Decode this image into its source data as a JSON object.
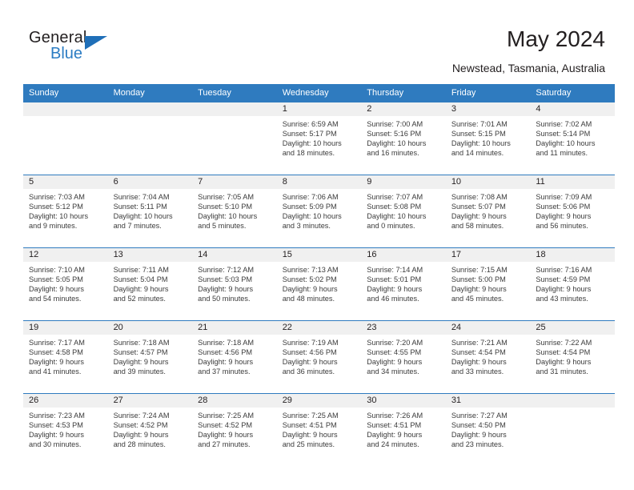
{
  "brand": {
    "name_top": "General",
    "name_bottom": "Blue",
    "triangle_icon": "triangle-icon",
    "accent_color": "#2f7bbf"
  },
  "header": {
    "title": "May 2024",
    "location": "Newstead, Tasmania, Australia"
  },
  "calendar": {
    "weekday_headers": [
      "Sunday",
      "Monday",
      "Tuesday",
      "Wednesday",
      "Thursday",
      "Friday",
      "Saturday"
    ],
    "header_bg": "#2f7bbf",
    "daynum_band_bg": "#f0f0f0",
    "weeks": [
      [
        {
          "day": "",
          "blank": true,
          "l1": "",
          "l2": "",
          "l3": "",
          "l4": ""
        },
        {
          "day": "",
          "blank": true,
          "l1": "",
          "l2": "",
          "l3": "",
          "l4": ""
        },
        {
          "day": "",
          "blank": true,
          "l1": "",
          "l2": "",
          "l3": "",
          "l4": ""
        },
        {
          "day": "1",
          "blank": false,
          "l1": "Sunrise: 6:59 AM",
          "l2": "Sunset: 5:17 PM",
          "l3": "Daylight: 10 hours",
          "l4": "and 18 minutes."
        },
        {
          "day": "2",
          "blank": false,
          "l1": "Sunrise: 7:00 AM",
          "l2": "Sunset: 5:16 PM",
          "l3": "Daylight: 10 hours",
          "l4": "and 16 minutes."
        },
        {
          "day": "3",
          "blank": false,
          "l1": "Sunrise: 7:01 AM",
          "l2": "Sunset: 5:15 PM",
          "l3": "Daylight: 10 hours",
          "l4": "and 14 minutes."
        },
        {
          "day": "4",
          "blank": false,
          "l1": "Sunrise: 7:02 AM",
          "l2": "Sunset: 5:14 PM",
          "l3": "Daylight: 10 hours",
          "l4": "and 11 minutes."
        }
      ],
      [
        {
          "day": "5",
          "blank": false,
          "l1": "Sunrise: 7:03 AM",
          "l2": "Sunset: 5:12 PM",
          "l3": "Daylight: 10 hours",
          "l4": "and 9 minutes."
        },
        {
          "day": "6",
          "blank": false,
          "l1": "Sunrise: 7:04 AM",
          "l2": "Sunset: 5:11 PM",
          "l3": "Daylight: 10 hours",
          "l4": "and 7 minutes."
        },
        {
          "day": "7",
          "blank": false,
          "l1": "Sunrise: 7:05 AM",
          "l2": "Sunset: 5:10 PM",
          "l3": "Daylight: 10 hours",
          "l4": "and 5 minutes."
        },
        {
          "day": "8",
          "blank": false,
          "l1": "Sunrise: 7:06 AM",
          "l2": "Sunset: 5:09 PM",
          "l3": "Daylight: 10 hours",
          "l4": "and 3 minutes."
        },
        {
          "day": "9",
          "blank": false,
          "l1": "Sunrise: 7:07 AM",
          "l2": "Sunset: 5:08 PM",
          "l3": "Daylight: 10 hours",
          "l4": "and 0 minutes."
        },
        {
          "day": "10",
          "blank": false,
          "l1": "Sunrise: 7:08 AM",
          "l2": "Sunset: 5:07 PM",
          "l3": "Daylight: 9 hours",
          "l4": "and 58 minutes."
        },
        {
          "day": "11",
          "blank": false,
          "l1": "Sunrise: 7:09 AM",
          "l2": "Sunset: 5:06 PM",
          "l3": "Daylight: 9 hours",
          "l4": "and 56 minutes."
        }
      ],
      [
        {
          "day": "12",
          "blank": false,
          "l1": "Sunrise: 7:10 AM",
          "l2": "Sunset: 5:05 PM",
          "l3": "Daylight: 9 hours",
          "l4": "and 54 minutes."
        },
        {
          "day": "13",
          "blank": false,
          "l1": "Sunrise: 7:11 AM",
          "l2": "Sunset: 5:04 PM",
          "l3": "Daylight: 9 hours",
          "l4": "and 52 minutes."
        },
        {
          "day": "14",
          "blank": false,
          "l1": "Sunrise: 7:12 AM",
          "l2": "Sunset: 5:03 PM",
          "l3": "Daylight: 9 hours",
          "l4": "and 50 minutes."
        },
        {
          "day": "15",
          "blank": false,
          "l1": "Sunrise: 7:13 AM",
          "l2": "Sunset: 5:02 PM",
          "l3": "Daylight: 9 hours",
          "l4": "and 48 minutes."
        },
        {
          "day": "16",
          "blank": false,
          "l1": "Sunrise: 7:14 AM",
          "l2": "Sunset: 5:01 PM",
          "l3": "Daylight: 9 hours",
          "l4": "and 46 minutes."
        },
        {
          "day": "17",
          "blank": false,
          "l1": "Sunrise: 7:15 AM",
          "l2": "Sunset: 5:00 PM",
          "l3": "Daylight: 9 hours",
          "l4": "and 45 minutes."
        },
        {
          "day": "18",
          "blank": false,
          "l1": "Sunrise: 7:16 AM",
          "l2": "Sunset: 4:59 PM",
          "l3": "Daylight: 9 hours",
          "l4": "and 43 minutes."
        }
      ],
      [
        {
          "day": "19",
          "blank": false,
          "l1": "Sunrise: 7:17 AM",
          "l2": "Sunset: 4:58 PM",
          "l3": "Daylight: 9 hours",
          "l4": "and 41 minutes."
        },
        {
          "day": "20",
          "blank": false,
          "l1": "Sunrise: 7:18 AM",
          "l2": "Sunset: 4:57 PM",
          "l3": "Daylight: 9 hours",
          "l4": "and 39 minutes."
        },
        {
          "day": "21",
          "blank": false,
          "l1": "Sunrise: 7:18 AM",
          "l2": "Sunset: 4:56 PM",
          "l3": "Daylight: 9 hours",
          "l4": "and 37 minutes."
        },
        {
          "day": "22",
          "blank": false,
          "l1": "Sunrise: 7:19 AM",
          "l2": "Sunset: 4:56 PM",
          "l3": "Daylight: 9 hours",
          "l4": "and 36 minutes."
        },
        {
          "day": "23",
          "blank": false,
          "l1": "Sunrise: 7:20 AM",
          "l2": "Sunset: 4:55 PM",
          "l3": "Daylight: 9 hours",
          "l4": "and 34 minutes."
        },
        {
          "day": "24",
          "blank": false,
          "l1": "Sunrise: 7:21 AM",
          "l2": "Sunset: 4:54 PM",
          "l3": "Daylight: 9 hours",
          "l4": "and 33 minutes."
        },
        {
          "day": "25",
          "blank": false,
          "l1": "Sunrise: 7:22 AM",
          "l2": "Sunset: 4:54 PM",
          "l3": "Daylight: 9 hours",
          "l4": "and 31 minutes."
        }
      ],
      [
        {
          "day": "26",
          "blank": false,
          "l1": "Sunrise: 7:23 AM",
          "l2": "Sunset: 4:53 PM",
          "l3": "Daylight: 9 hours",
          "l4": "and 30 minutes."
        },
        {
          "day": "27",
          "blank": false,
          "l1": "Sunrise: 7:24 AM",
          "l2": "Sunset: 4:52 PM",
          "l3": "Daylight: 9 hours",
          "l4": "and 28 minutes."
        },
        {
          "day": "28",
          "blank": false,
          "l1": "Sunrise: 7:25 AM",
          "l2": "Sunset: 4:52 PM",
          "l3": "Daylight: 9 hours",
          "l4": "and 27 minutes."
        },
        {
          "day": "29",
          "blank": false,
          "l1": "Sunrise: 7:25 AM",
          "l2": "Sunset: 4:51 PM",
          "l3": "Daylight: 9 hours",
          "l4": "and 25 minutes."
        },
        {
          "day": "30",
          "blank": false,
          "l1": "Sunrise: 7:26 AM",
          "l2": "Sunset: 4:51 PM",
          "l3": "Daylight: 9 hours",
          "l4": "and 24 minutes."
        },
        {
          "day": "31",
          "blank": false,
          "l1": "Sunrise: 7:27 AM",
          "l2": "Sunset: 4:50 PM",
          "l3": "Daylight: 9 hours",
          "l4": "and 23 minutes."
        },
        {
          "day": "",
          "blank": true,
          "l1": "",
          "l2": "",
          "l3": "",
          "l4": ""
        }
      ]
    ]
  }
}
